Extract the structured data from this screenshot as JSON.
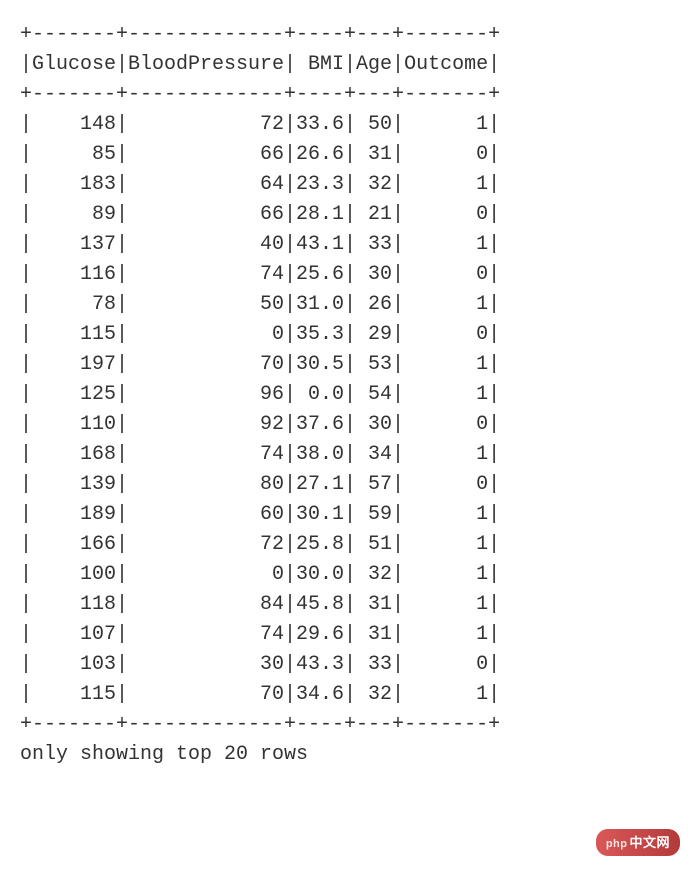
{
  "table": {
    "columns": [
      "Glucose",
      "BloodPressure",
      "BMI",
      "Age",
      "Outcome"
    ],
    "widths": [
      7,
      13,
      4,
      3,
      7
    ],
    "rows": [
      {
        "Glucose": "148",
        "BloodPressure": "72",
        "BMI": "33.6",
        "Age": "50",
        "Outcome": "1"
      },
      {
        "Glucose": "85",
        "BloodPressure": "66",
        "BMI": "26.6",
        "Age": "31",
        "Outcome": "0"
      },
      {
        "Glucose": "183",
        "BloodPressure": "64",
        "BMI": "23.3",
        "Age": "32",
        "Outcome": "1"
      },
      {
        "Glucose": "89",
        "BloodPressure": "66",
        "BMI": "28.1",
        "Age": "21",
        "Outcome": "0"
      },
      {
        "Glucose": "137",
        "BloodPressure": "40",
        "BMI": "43.1",
        "Age": "33",
        "Outcome": "1"
      },
      {
        "Glucose": "116",
        "BloodPressure": "74",
        "BMI": "25.6",
        "Age": "30",
        "Outcome": "0"
      },
      {
        "Glucose": "78",
        "BloodPressure": "50",
        "BMI": "31.0",
        "Age": "26",
        "Outcome": "1"
      },
      {
        "Glucose": "115",
        "BloodPressure": "0",
        "BMI": "35.3",
        "Age": "29",
        "Outcome": "0"
      },
      {
        "Glucose": "197",
        "BloodPressure": "70",
        "BMI": "30.5",
        "Age": "53",
        "Outcome": "1"
      },
      {
        "Glucose": "125",
        "BloodPressure": "96",
        "BMI": "0.0",
        "Age": "54",
        "Outcome": "1"
      },
      {
        "Glucose": "110",
        "BloodPressure": "92",
        "BMI": "37.6",
        "Age": "30",
        "Outcome": "0"
      },
      {
        "Glucose": "168",
        "BloodPressure": "74",
        "BMI": "38.0",
        "Age": "34",
        "Outcome": "1"
      },
      {
        "Glucose": "139",
        "BloodPressure": "80",
        "BMI": "27.1",
        "Age": "57",
        "Outcome": "0"
      },
      {
        "Glucose": "189",
        "BloodPressure": "60",
        "BMI": "30.1",
        "Age": "59",
        "Outcome": "1"
      },
      {
        "Glucose": "166",
        "BloodPressure": "72",
        "BMI": "25.8",
        "Age": "51",
        "Outcome": "1"
      },
      {
        "Glucose": "100",
        "BloodPressure": "0",
        "BMI": "30.0",
        "Age": "32",
        "Outcome": "1"
      },
      {
        "Glucose": "118",
        "BloodPressure": "84",
        "BMI": "45.8",
        "Age": "31",
        "Outcome": "1"
      },
      {
        "Glucose": "107",
        "BloodPressure": "74",
        "BMI": "29.6",
        "Age": "31",
        "Outcome": "1"
      },
      {
        "Glucose": "103",
        "BloodPressure": "30",
        "BMI": "43.3",
        "Age": "33",
        "Outcome": "0"
      },
      {
        "Glucose": "115",
        "BloodPressure": "70",
        "BMI": "34.6",
        "Age": "32",
        "Outcome": "1"
      }
    ]
  },
  "footer_note": "only showing top 20 rows",
  "watermark": {
    "prefix": "php",
    "text": "中文网"
  }
}
